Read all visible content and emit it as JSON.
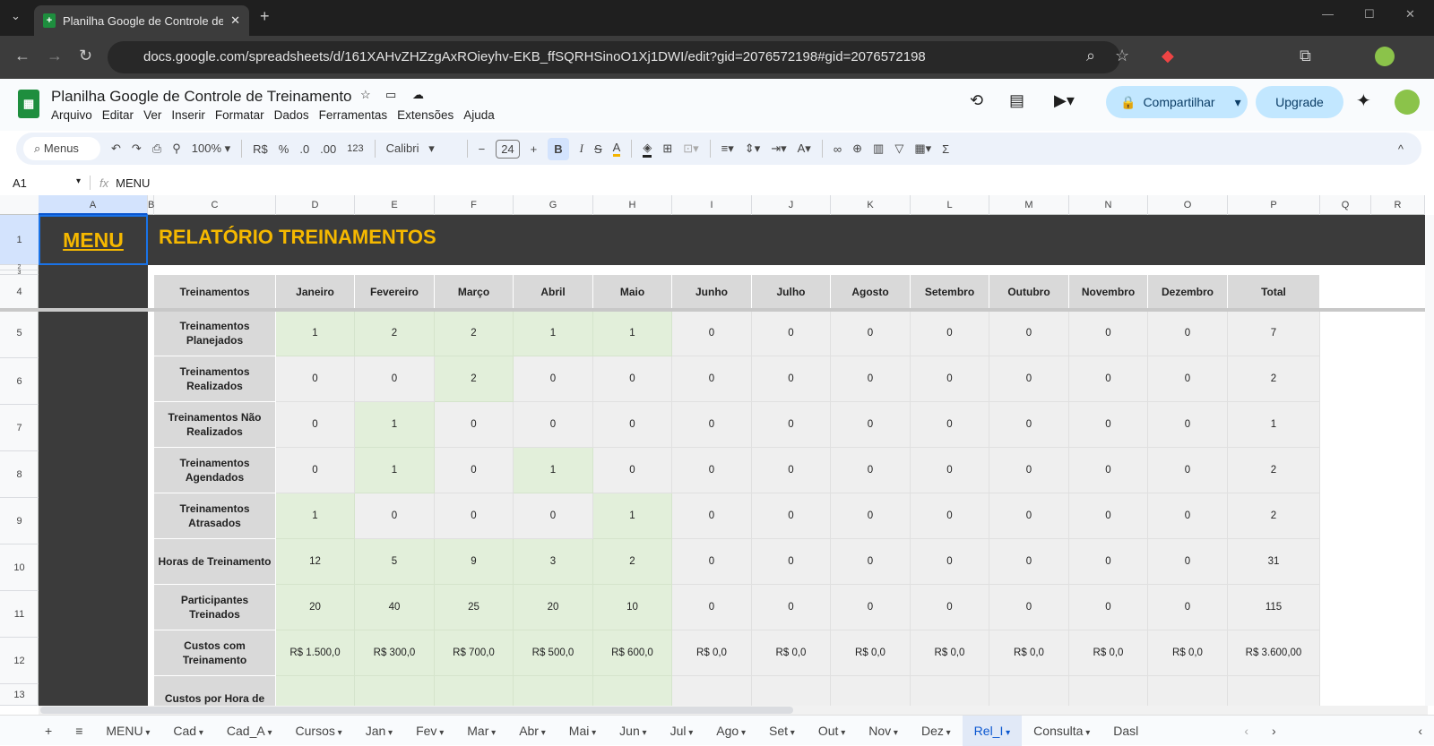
{
  "browser": {
    "tab_title": "Planilha Google de Controle de",
    "url": "docs.google.com/spreadsheets/d/161XAHvZHZzgAxROieyhv-EKB_ffSQRHSinoO1Xj1DWI/edit?gid=2076572198#gid=2076572198"
  },
  "app": {
    "title": "Planilha  Google de Controle de Treinamento",
    "menus": [
      "Arquivo",
      "Editar",
      "Ver",
      "Inserir",
      "Formatar",
      "Dados",
      "Ferramentas",
      "Extensões",
      "Ajuda"
    ],
    "share": "Compartilhar",
    "upgrade": "Upgrade"
  },
  "toolbar": {
    "search": "Menus",
    "zoom": "100%",
    "currency": "R$",
    "percent": "%",
    "dec_less": ".0",
    "dec_more": ".00",
    "number_format": "123",
    "font": "Calibri",
    "font_size": "24",
    "bold": "B",
    "italic": "I"
  },
  "formula": {
    "cell_ref": "A1",
    "fx": "fx",
    "value": "MENU"
  },
  "columns": [
    "A",
    "B",
    "C",
    "D",
    "E",
    "F",
    "G",
    "H",
    "I",
    "J",
    "K",
    "L",
    "M",
    "N",
    "O",
    "P",
    "Q",
    "R"
  ],
  "rows": [
    "1",
    "2",
    "3",
    "4",
    "5",
    "6",
    "7",
    "8",
    "9",
    "10",
    "11",
    "12",
    "13"
  ],
  "sheet": {
    "menu_link": "MENU",
    "title": "RELATÓRIO TREINAMENTOS",
    "headers": [
      "Treinamentos",
      "Janeiro",
      "Fevereiro",
      "Março",
      "Abril",
      "Maio",
      "Junho",
      "Julho",
      "Agosto",
      "Setembro",
      "Outubro",
      "Novembro",
      "Dezembro",
      "Total"
    ],
    "data": [
      {
        "label": "Treinamentos Planejados",
        "values": [
          "1",
          "2",
          "2",
          "1",
          "1",
          "0",
          "0",
          "0",
          "0",
          "0",
          "0",
          "0",
          "7"
        ],
        "highlight": [
          0,
          1,
          2,
          3,
          4
        ]
      },
      {
        "label": "Treinamentos Realizados",
        "values": [
          "0",
          "0",
          "2",
          "0",
          "0",
          "0",
          "0",
          "0",
          "0",
          "0",
          "0",
          "0",
          "2"
        ],
        "highlight": [
          2
        ]
      },
      {
        "label": "Treinamentos Não Realizados",
        "values": [
          "0",
          "1",
          "0",
          "0",
          "0",
          "0",
          "0",
          "0",
          "0",
          "0",
          "0",
          "0",
          "1"
        ],
        "highlight": [
          1
        ]
      },
      {
        "label": "Treinamentos Agendados",
        "values": [
          "0",
          "1",
          "0",
          "1",
          "0",
          "0",
          "0",
          "0",
          "0",
          "0",
          "0",
          "0",
          "2"
        ],
        "highlight": [
          1,
          3
        ]
      },
      {
        "label": "Treinamentos Atrasados",
        "values": [
          "1",
          "0",
          "0",
          "0",
          "1",
          "0",
          "0",
          "0",
          "0",
          "0",
          "0",
          "0",
          "2"
        ],
        "highlight": [
          0,
          4
        ]
      },
      {
        "label": "Horas de Treinamento",
        "values": [
          "12",
          "5",
          "9",
          "3",
          "2",
          "0",
          "0",
          "0",
          "0",
          "0",
          "0",
          "0",
          "31"
        ],
        "highlight": [
          0,
          1,
          2,
          3,
          4
        ]
      },
      {
        "label": "Participantes Treinados",
        "values": [
          "20",
          "40",
          "25",
          "20",
          "10",
          "0",
          "0",
          "0",
          "0",
          "0",
          "0",
          "0",
          "115"
        ],
        "highlight": [
          0,
          1,
          2,
          3,
          4
        ]
      },
      {
        "label": "Custos com Treinamento",
        "values": [
          "R$ 1.500,0",
          "R$ 300,0",
          "R$ 700,0",
          "R$ 500,0",
          "R$ 600,0",
          "R$ 0,0",
          "R$ 0,0",
          "R$ 0,0",
          "R$ 0,0",
          "R$ 0,0",
          "R$ 0,0",
          "R$ 0,0",
          "R$ 3.600,00"
        ],
        "highlight": [
          0,
          1,
          2,
          3,
          4
        ]
      },
      {
        "label": "Custos por Hora de",
        "values": [
          "",
          "",
          "",
          "",
          "",
          "",
          "",
          "",
          "",
          "",
          "",
          "",
          ""
        ],
        "highlight": [
          0,
          1,
          2,
          3,
          4
        ]
      }
    ]
  },
  "sheet_tabs": [
    "MENU",
    "Cad",
    "Cad_A",
    "Cursos",
    "Jan",
    "Fev",
    "Mar",
    "Abr",
    "Mai",
    "Jun",
    "Jul",
    "Ago",
    "Set",
    "Out",
    "Nov",
    "Dez",
    "Rel_I",
    "Consulta",
    "Dasl"
  ],
  "active_sheet": "Rel_I"
}
